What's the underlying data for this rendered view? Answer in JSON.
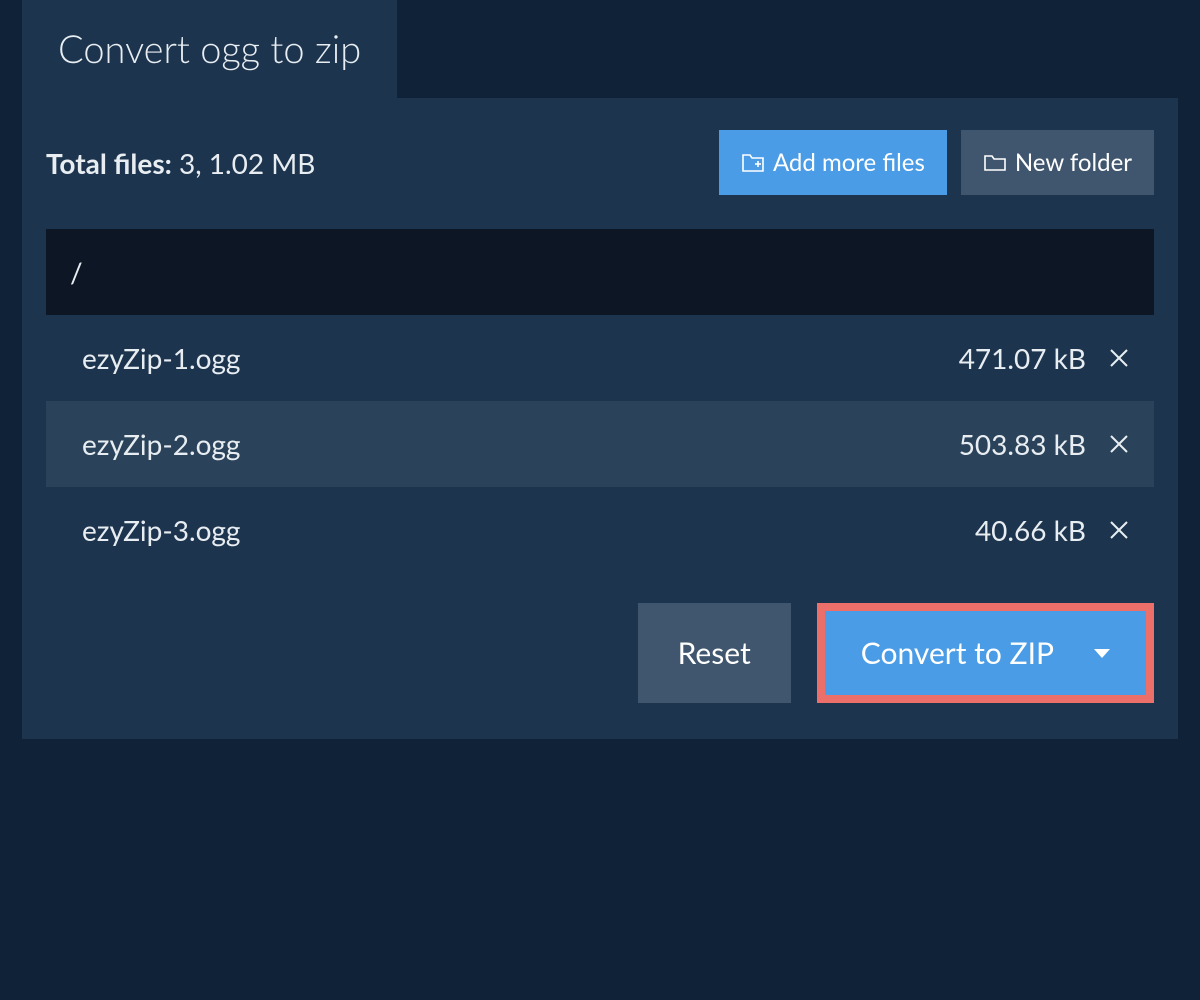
{
  "tab": {
    "title": "Convert ogg to zip"
  },
  "summary": {
    "label": "Total files:",
    "value": "3, 1.02 MB"
  },
  "buttons": {
    "add_more": "Add more files",
    "new_folder": "New folder",
    "reset": "Reset",
    "convert": "Convert to ZIP"
  },
  "path": "/",
  "files": [
    {
      "name": "ezyZip-1.ogg",
      "size": "471.07 kB"
    },
    {
      "name": "ezyZip-2.ogg",
      "size": "503.83 kB"
    },
    {
      "name": "ezyZip-3.ogg",
      "size": "40.66 kB"
    }
  ]
}
